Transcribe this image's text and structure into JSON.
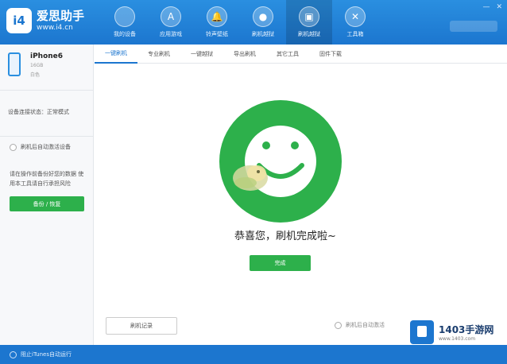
{
  "app": {
    "name": "爱思助手",
    "url": "www.i4.cn",
    "logo": "i4"
  },
  "nav": [
    {
      "label": "我的设备",
      "icon": "apple-icon",
      "glyph": ""
    },
    {
      "label": "应用游戏",
      "icon": "app-store-icon",
      "glyph": "A"
    },
    {
      "label": "铃声壁纸",
      "icon": "bell-icon",
      "glyph": "🔔"
    },
    {
      "label": "刷机越狱",
      "icon": "flash-icon",
      "glyph": "●"
    },
    {
      "label": "刷机越狱",
      "icon": "box-icon",
      "glyph": "▣"
    },
    {
      "label": "工具箱",
      "icon": "tools-icon",
      "glyph": "✕"
    }
  ],
  "nav_active_index": 4,
  "device": {
    "name": "iPhone6",
    "sub1": "16GB",
    "sub2": "白色"
  },
  "left_panel": {
    "connection_status": "设备连接状态：正常模式",
    "auto_activate": "刷机后自动激活设备",
    "warning": "请在操作前备份好您的数据 使用本工具请自行承担风险",
    "green_button": "备份 / 恢复"
  },
  "tabs": [
    "一键刷机",
    "专业刷机",
    "一键越狱",
    "导出刷机",
    "其它工具",
    "固件下载"
  ],
  "tab_active_index": 0,
  "main": {
    "success_message": "恭喜您，刷机完成啦~",
    "finish_button": "完成",
    "bottom_left_button": "刷机记录",
    "bottom_option": "刷机后自动激活"
  },
  "watermark": {
    "main": "1403手游网",
    "sub": "www.1403.com"
  },
  "statusbar": {
    "text": "阻止iTunes自动运行"
  },
  "colors": {
    "brand_blue": "#1c76cf",
    "success_green": "#2db04b"
  }
}
